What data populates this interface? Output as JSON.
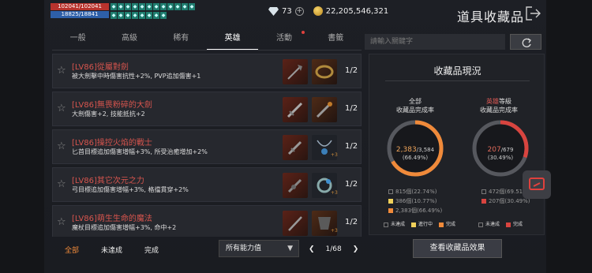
{
  "status": {
    "hp": "102041/102041",
    "mp": "18825/18841"
  },
  "currency": {
    "diamond": "73",
    "gold": "22,205,546,321"
  },
  "title": "道具收藏品",
  "tabs": [
    "一般",
    "高級",
    "稀有",
    "英雄",
    "活動",
    "書籤"
  ],
  "active_tab": "英雄",
  "search": {
    "placeholder": "請輸入關鍵字"
  },
  "items": [
    {
      "name": "[LV86]從屬對劍",
      "desc": "被大劍擊中時傷害抗性+2%, PVP追加傷害+1",
      "count": "1/2"
    },
    {
      "name": "[LV86]無畏粉碎的大劍",
      "desc": "大劍傷害+2, 技能抵抗+2",
      "count": "1/2"
    },
    {
      "name": "[LV86]操控火焰的戰士",
      "desc": "匕首目標追加傷害增幅+3%, 所受治癒增加+2%",
      "count": "1/2"
    },
    {
      "name": "[LV86]其它次元之力",
      "desc": "弓目標追加傷害增幅+3%, 格擋貫穿+2%",
      "count": "1/2"
    },
    {
      "name": "[LV86]萌生生命的魔法",
      "desc": "魔杖目標追加傷害增幅+3%, 命中+2",
      "count": "1/2"
    }
  ],
  "badge": "+3",
  "filters": [
    "全部",
    "未達成",
    "完成"
  ],
  "select": "所有能力值",
  "pager": {
    "page": "1/68"
  },
  "panel": {
    "title": "收藏品現況",
    "all": {
      "label": "全部",
      "sub": "收藏品完成率",
      "done": "2,383",
      "total": "/3,584",
      "pct": "(66.49%)",
      "progress": 0.6649,
      "legend": [
        "815個(22.74%)",
        "386個(10.77%)",
        "2,383個(66.49%)"
      ]
    },
    "hero": {
      "label": "英雄",
      "label_suffix": "等級",
      "sub": "收藏品完成率",
      "done": "207",
      "total": "/679",
      "pct": "(30.49%)",
      "progress": 0.3049,
      "legend": [
        "472個(69.51%)",
        "207個(30.49%)"
      ]
    },
    "legend_left": [
      "未達成",
      "進行中",
      "完成"
    ],
    "legend_right": [
      "未達成",
      "完成"
    ]
  },
  "button": "查看收藏品效果",
  "colors": {
    "orange": "#f08a3a",
    "red": "#d8443f",
    "gray": "#555",
    "accent": "#e9a04f"
  }
}
